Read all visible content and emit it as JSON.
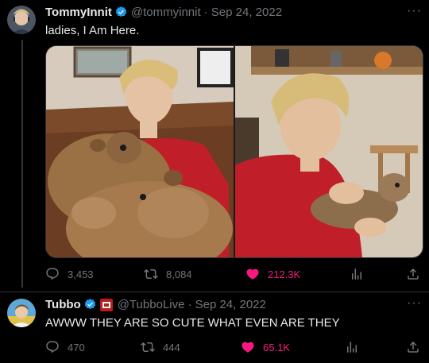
{
  "tweet1": {
    "display_name": "TommyInnit",
    "handle": "@tommyinnit",
    "date": "· Sep 24, 2022",
    "text": "ladies, I Am Here.",
    "more": "···",
    "stats": {
      "replies": "3,453",
      "retweets": "8,084",
      "likes": "212.3K"
    },
    "photo_left_alt": "Blond young man in red t-shirt sitting on a brown leather couch with two capybaras",
    "photo_right_alt": "Blond young man in red t-shirt holding a small prairie dog"
  },
  "tweet2": {
    "display_name": "Tubbo",
    "handle": "@TubboLive",
    "date": "· Sep 24, 2022",
    "text": "AWWW THEY ARE SO CUTE WHAT EVEN ARE THEY",
    "more": "···",
    "stats": {
      "replies": "470",
      "retweets": "444",
      "likes": "65.1K"
    }
  },
  "colors": {
    "background": "#000000",
    "text": "#e7e9ea",
    "muted": "#71767b",
    "like": "#f91880",
    "verified": "#1d9bf0"
  },
  "icons": [
    "reply-icon",
    "retweet-icon",
    "heart-icon",
    "views-icon",
    "share-icon",
    "verified-icon",
    "more-icon"
  ]
}
